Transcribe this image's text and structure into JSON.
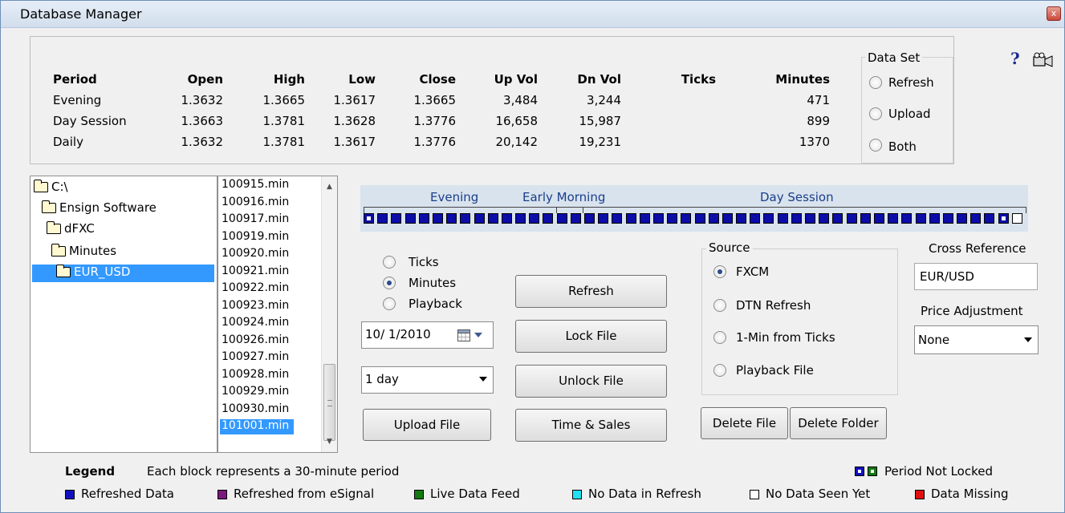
{
  "window": {
    "title": "Database Manager",
    "close_glyph": "x"
  },
  "stats": {
    "headers": [
      "Period",
      "Open",
      "High",
      "Low",
      "Close",
      "Up Vol",
      "Dn Vol",
      "Ticks",
      "Minutes"
    ],
    "rows": [
      [
        "Evening",
        "1.3632",
        "1.3665",
        "1.3617",
        "1.3665",
        "3,484",
        "3,244",
        "",
        "471"
      ],
      [
        "Day Session",
        "1.3663",
        "1.3781",
        "1.3628",
        "1.3776",
        "16,658",
        "15,987",
        "",
        "899"
      ],
      [
        "Daily",
        "1.3632",
        "1.3781",
        "1.3617",
        "1.3776",
        "20,142",
        "19,231",
        "",
        "1370"
      ]
    ]
  },
  "data_set": {
    "legend": "Data Set",
    "options": [
      "Refresh",
      "Upload",
      "Both"
    ],
    "selected": null
  },
  "toolbar_icons": {
    "help": "?",
    "camera": "camera-icon"
  },
  "tree": {
    "items": [
      "C:\\",
      "Ensign Software",
      "dFXC",
      "Minutes",
      "EUR_USD"
    ],
    "selected": "EUR_USD"
  },
  "files": {
    "items": [
      "100915.min",
      "100916.min",
      "100917.min",
      "100919.min",
      "100920.min",
      "100921.min",
      "100922.min",
      "100923.min",
      "100924.min",
      "100926.min",
      "100927.min",
      "100928.min",
      "100929.min",
      "100930.min",
      "101001.min"
    ],
    "selected": "101001.min"
  },
  "timeline": {
    "labels": {
      "evening": "Evening",
      "early_morning": "Early Morning",
      "day_session": "Day Session"
    },
    "block_count": 48,
    "colors": {
      "refreshed": "#0c0ca8",
      "no_data_seen": "#ffffff"
    }
  },
  "mode": {
    "options": [
      "Ticks",
      "Minutes",
      "Playback"
    ],
    "selected": "Minutes"
  },
  "date_picker": {
    "value": "10/ 1/2010"
  },
  "range_select": {
    "value": "1 day"
  },
  "buttons": {
    "refresh": "Refresh",
    "lock_file": "Lock File",
    "unlock_file": "Unlock File",
    "upload_file": "Upload File",
    "time_sales": "Time & Sales",
    "delete_file": "Delete File",
    "delete_folder": "Delete Folder"
  },
  "source": {
    "legend": "Source",
    "options": [
      "FXCM",
      "DTN Refresh",
      "1-Min from Ticks",
      "Playback File"
    ],
    "selected": "FXCM"
  },
  "cross_reference": {
    "label": "Cross Reference",
    "value": "EUR/USD"
  },
  "price_adjustment": {
    "label": "Price Adjustment",
    "value": "None"
  },
  "legend": {
    "title": "Legend",
    "description": "Each block represents a 30-minute period",
    "period_not_locked": "Period Not Locked",
    "items": [
      {
        "label": "Refreshed Data",
        "color": "#1010c0"
      },
      {
        "label": "Refreshed from eSignal",
        "color": "#7a1a7a"
      },
      {
        "label": "Live Data Feed",
        "color": "#137a13"
      },
      {
        "label": "No Data in Refresh",
        "color": "#22e0f0"
      },
      {
        "label": "No Data Seen Yet",
        "color": "#ffffff"
      },
      {
        "label": "Data Missing",
        "color": "#e01010"
      }
    ]
  }
}
